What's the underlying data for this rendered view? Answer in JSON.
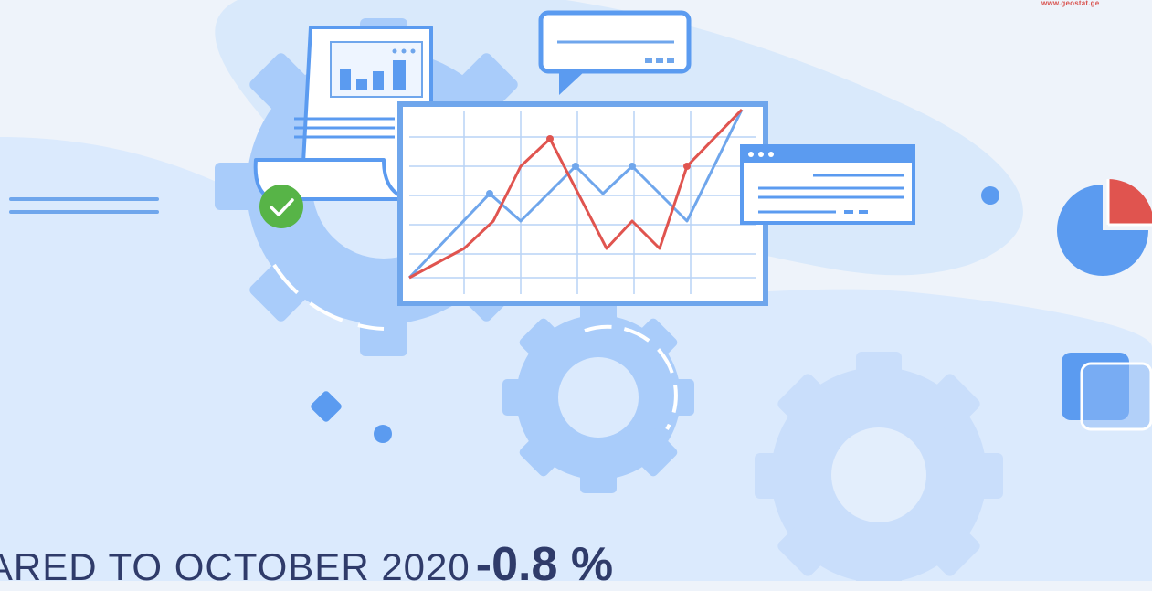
{
  "header": {
    "website": "www.geostat.ge"
  },
  "caption": {
    "text": "PARED TO OCTOBER 2020",
    "value": "-0.8 %"
  },
  "colors": {
    "background": "#eef3fa",
    "blob": "#d9e9fb",
    "gear_large": "#a9ccfa",
    "gear_pale": "#c9defb",
    "accent_blue": "#5b9bf0",
    "line_blue": "#6fa6ec",
    "line_red": "#e0544f",
    "check_green": "#57b447",
    "caption_text": "#2f3b6a"
  },
  "icons": {
    "illustration": "data-analytics-illustration",
    "check": "check-icon",
    "pie": "pie-chart-icon",
    "cards": "stacked-cards-icon",
    "gear": "gear-icon"
  }
}
